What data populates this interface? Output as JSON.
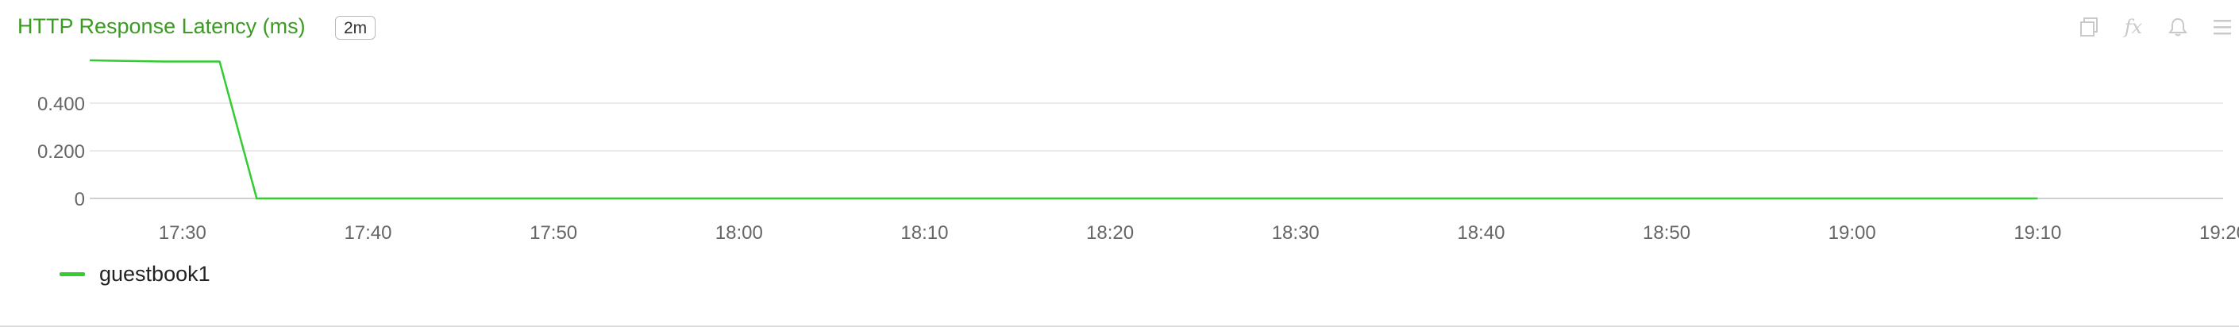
{
  "panel": {
    "title": "HTTP Response Latency (ms)",
    "interval_badge": "2m"
  },
  "toolbar": {
    "icons": [
      "copy-icon",
      "fx-icon",
      "bell-icon",
      "menu-icon"
    ],
    "fx_label": "fx"
  },
  "colors": {
    "title": "#3b9c23",
    "series": "#33cc33",
    "grid": "#e3e3e3",
    "axis_text": "#666666"
  },
  "chart_data": {
    "type": "line",
    "title": "HTTP Response Latency (ms)",
    "xlabel": "",
    "ylabel": "",
    "x_ticks": [
      "17:30",
      "17:40",
      "17:50",
      "18:00",
      "18:10",
      "18:20",
      "18:30",
      "18:40",
      "18:50",
      "19:00",
      "19:10",
      "19:20"
    ],
    "y_ticks": [
      "0",
      "0.200",
      "0.400"
    ],
    "xlim": [
      "17:25",
      "19:20"
    ],
    "ylim": [
      0,
      0.6
    ],
    "grid": true,
    "legend_position": "bottom-left",
    "series": [
      {
        "name": "guestbook1",
        "x": [
          "17:25",
          "17:29",
          "17:32",
          "17:34",
          "17:40",
          "17:50",
          "18:00",
          "18:10",
          "18:20",
          "18:30",
          "18:40",
          "18:50",
          "19:00",
          "19:10"
        ],
        "values": [
          0.58,
          0.575,
          0.575,
          0.0,
          0.0,
          0.0,
          0.0,
          0.0,
          0.0,
          0.0,
          0.0,
          0.0,
          0.0,
          0.0
        ]
      }
    ]
  }
}
